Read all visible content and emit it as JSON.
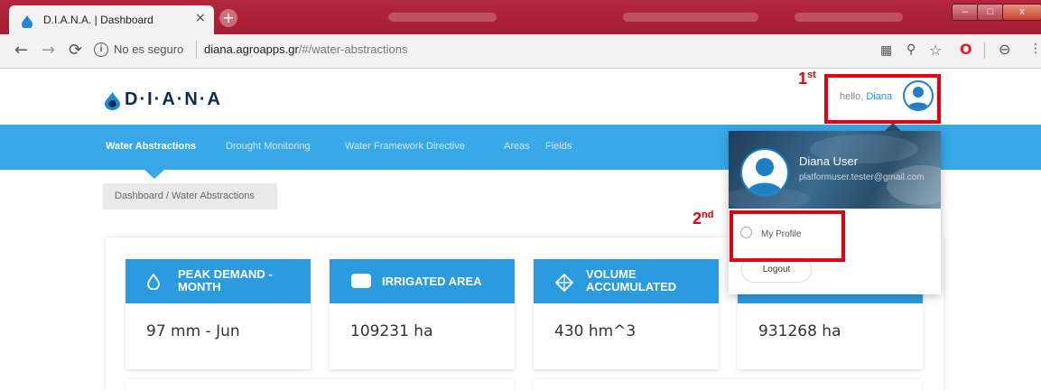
{
  "browser": {
    "tab_title": "D.I.A.N.A. | Dashboard",
    "tab_close": "×",
    "new_tab": "+",
    "security_text": "No es seguro",
    "url_host": "diana.agroapps.gr",
    "url_path": "/#/water-abstractions",
    "window_minimize": "–",
    "window_maximize": "□",
    "window_close": "x"
  },
  "header": {
    "logo_text": "D·I·A·N·A",
    "hello_prefix": "hello,",
    "user_first_name": "Diana"
  },
  "nav": {
    "items": [
      {
        "label": "Water Abstractions",
        "active": true
      },
      {
        "label": "Drought Monitoring"
      },
      {
        "label": "Water Framework Directive"
      },
      {
        "label": "Areas"
      },
      {
        "label": "Fields"
      }
    ]
  },
  "breadcrumb": "Dashboard  / Water Abstractions",
  "cards": [
    {
      "title_line1": "PEAK DEMAND -",
      "title_line2": "MONTH",
      "value": "97 mm - Jun",
      "icon": "droplet-icon"
    },
    {
      "title_line1": "IRRIGATED AREA",
      "title_line2": "",
      "value": "109231 ha",
      "icon": "area-icon"
    },
    {
      "title_line1": "VOLUME",
      "title_line2": "ACCUMULATED",
      "value": "430 hm^3",
      "icon": "cube-icon"
    },
    {
      "title_line1": "",
      "title_line2": "",
      "value": "931268 ha",
      "icon": ""
    }
  ],
  "dropdown": {
    "user_name": "Diana User",
    "email": "platformuser.tester@gmail.com",
    "profile_label": "My Profile",
    "logout_label": "Logout"
  },
  "annotations": {
    "first_num": "1",
    "first_sup": "st",
    "second_num": "2",
    "second_sup": "nd",
    "color": "#e0000f"
  },
  "colors": {
    "nav_blue": "#38a8e8",
    "card_blue": "#2b9be0",
    "chrome_red": "#a41d31"
  }
}
